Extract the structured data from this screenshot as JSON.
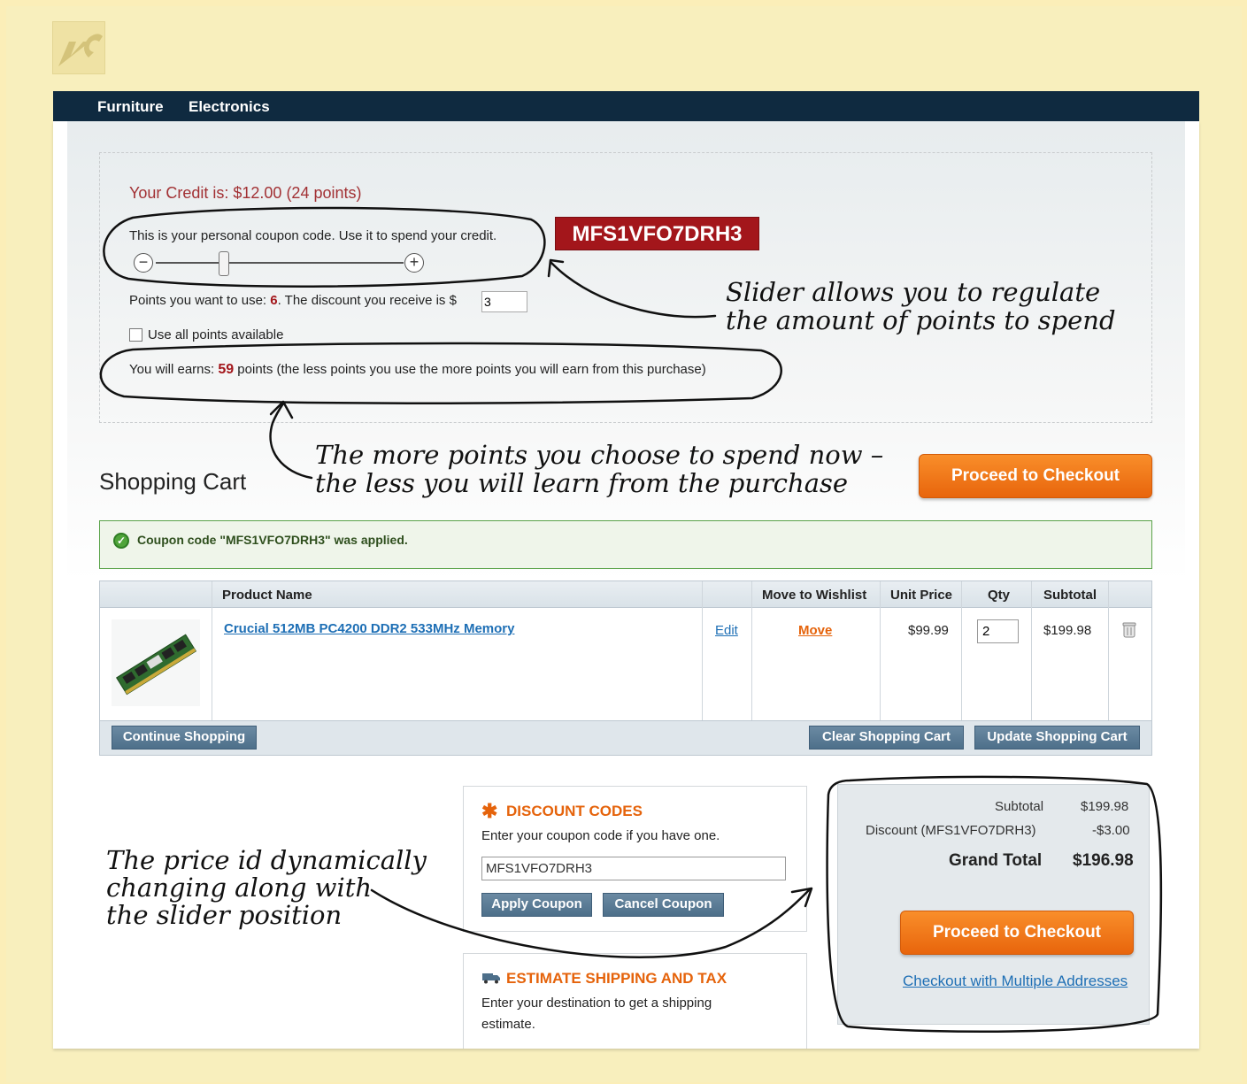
{
  "nav": {
    "items": [
      "Furniture",
      "Electronics"
    ]
  },
  "points": {
    "credit": "Your Credit is: $12.00 (24 points)",
    "coupon_text": "This is your personal coupon code. Use it to spend your credit.",
    "coupon_code": "MFS1VFO7DRH3",
    "points_prefix": "Points you want to use: ",
    "points_value": "6",
    "points_mid": ". The discount you receive is $",
    "discount_value": "3",
    "slider_level_points": 6,
    "use_all_label": "Use all points available",
    "earn_prefix": "You will earns: ",
    "earn_value": "59",
    "earn_suffix": " points (the less points you use the more points you will earn from this purchase)"
  },
  "annotations": {
    "slider_note_1": "Slider allows you to regulate",
    "slider_note_2": "the amount of points to spend",
    "points_note_1": "The more points you choose to spend now –",
    "points_note_2": "the less you will learn from the purchase",
    "price_note_1": "The price id dynamically",
    "price_note_2": "changing along with",
    "price_note_3": "the slider position"
  },
  "cart": {
    "title": "Shopping Cart",
    "checkout_label": "Proceed to Checkout",
    "message": "Coupon code \"MFS1VFO7DRH3\" was applied.",
    "columns": [
      "Product Name",
      "Move to Wishlist",
      "Unit Price",
      "Qty",
      "Subtotal"
    ],
    "item": {
      "name": "Crucial 512MB PC4200 DDR2 533MHz Memory",
      "edit": "Edit",
      "move": "Move",
      "unit_price": "$99.99",
      "qty": "2",
      "subtotal": "$199.98"
    },
    "continue_label": "Continue Shopping",
    "clear_label": "Clear Shopping Cart",
    "update_label": "Update Shopping Cart"
  },
  "discount": {
    "title": "DISCOUNT CODES",
    "text": "Enter your coupon code if you have one.",
    "code_value": "MFS1VFO7DRH3",
    "apply_label": "Apply Coupon",
    "cancel_label": "Cancel Coupon"
  },
  "shipping": {
    "title": "ESTIMATE SHIPPING AND TAX",
    "text_1": "Enter your destination to get a shipping",
    "text_2": "estimate."
  },
  "totals": {
    "subtotal_label": "Subtotal",
    "subtotal_value": "$199.98",
    "discount_label": "Discount (MFS1VFO7DRH3)",
    "discount_value": "-$3.00",
    "grand_label": "Grand Total",
    "grand_value": "$196.98",
    "checkout_label": "Proceed to Checkout",
    "multi_label": "Checkout with Multiple Addresses"
  },
  "colors": {
    "accent_orange": "#e5630b",
    "nav_bg": "#0f2a40",
    "coupon_red": "#a3161b",
    "link_blue": "#1e6fb5",
    "button_blue": "#4d6f8a",
    "success_green": "#4fa43a"
  }
}
